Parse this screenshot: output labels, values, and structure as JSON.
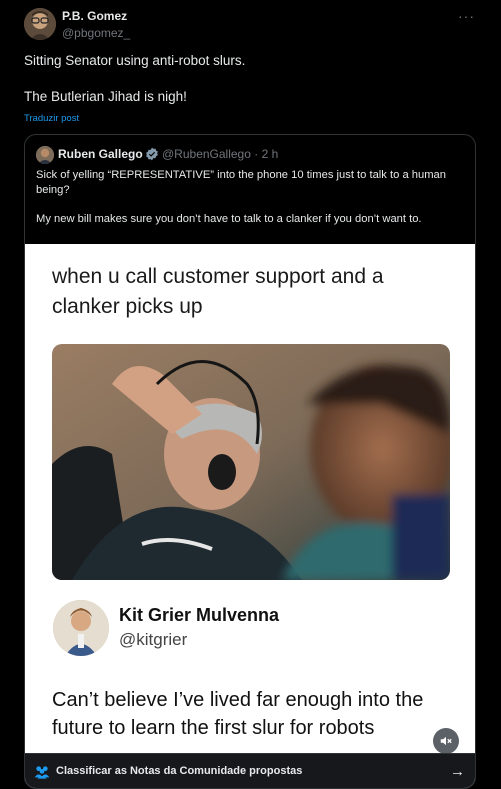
{
  "post": {
    "author_name": "P.B. Gomez",
    "author_handle": "@pbgomez_",
    "more_icon": "more-horizontal-icon",
    "text_lines": [
      "Sitting Senator using anti-robot slurs.",
      "The Butlerian Jihad is nigh!"
    ],
    "translate_label": "Traduzir post"
  },
  "quote": {
    "author_name": "Ruben Gallego",
    "author_handle": "@RubenGallego · 2 h",
    "verified_icon": "verified-badge-icon",
    "text_lines": [
      "Sick of yelling “REPRESENTATIVE” into the phone 10 times just to talk to a human being?",
      "My new bill makes sure you don’t have to talk to a clanker if you don’t want to."
    ]
  },
  "meme": {
    "caption": "when u call customer support and a clanker picks up",
    "tweet_name": "Kit Grier Mulvenna",
    "tweet_handle": "@kitgrier",
    "tweet_text": "Can’t believe I’ve lived far enough into the future to learn the first slur for robots",
    "mute_icon": "volume-muted-icon"
  },
  "community_notes": {
    "label": "Classificar as Notas da Comunidade propostas",
    "icon": "community-people-icon",
    "arrow_icon": "arrow-right-icon"
  },
  "colors": {
    "background": "#000000",
    "link": "#1d9bf0",
    "muted_text": "#71767b",
    "border": "#2f3336"
  }
}
